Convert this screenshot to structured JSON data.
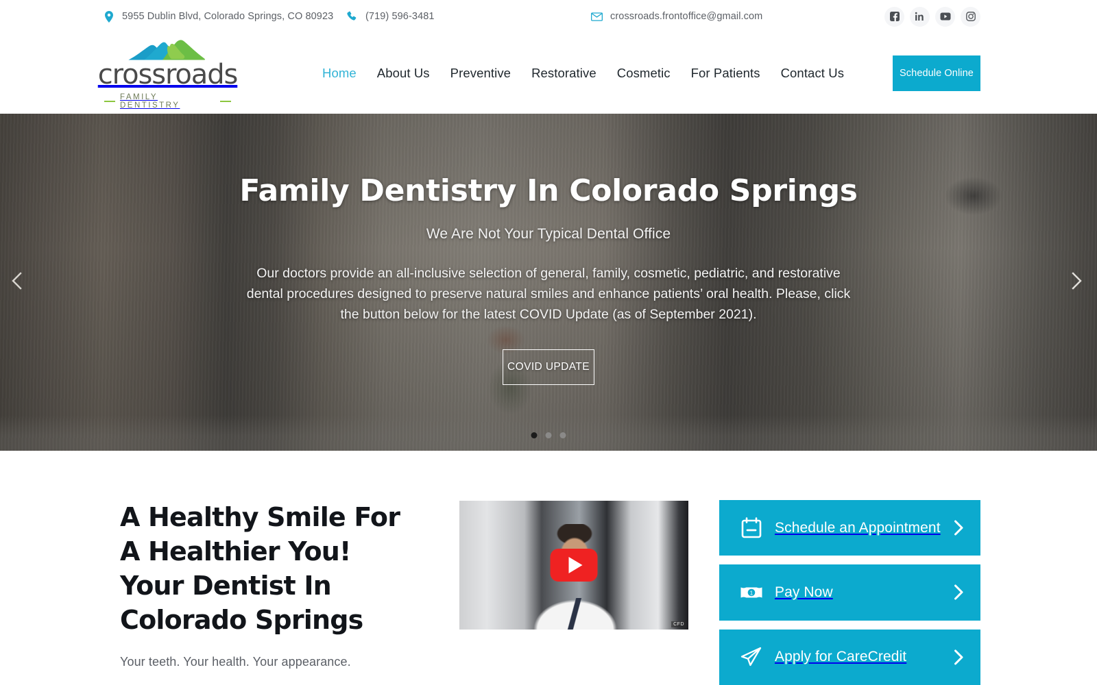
{
  "topbar": {
    "address": "5955 Dublin Blvd, Colorado Springs, CO 80923",
    "phone": "(719) 596-3481",
    "email": "crossroads.frontoffice@gmail.com",
    "socials": [
      {
        "name": "facebook-icon",
        "label": "Facebook"
      },
      {
        "name": "linkedin-icon",
        "label": "LinkedIn"
      },
      {
        "name": "youtube-icon",
        "label": "YouTube"
      },
      {
        "name": "instagram-icon",
        "label": "Instagram"
      }
    ]
  },
  "brand": {
    "name": "crossroads",
    "tagline": "FAMILY DENTISTRY",
    "mark_blue": "#1a9dc8",
    "mark_green": "#6cbe45"
  },
  "nav": {
    "items": [
      {
        "label": "Home",
        "active": true
      },
      {
        "label": "About Us",
        "active": false
      },
      {
        "label": "Preventive",
        "active": false
      },
      {
        "label": "Restorative",
        "active": false
      },
      {
        "label": "Cosmetic",
        "active": false
      },
      {
        "label": "For Patients",
        "active": false
      },
      {
        "label": "Contact Us",
        "active": false
      }
    ],
    "cta_label": "Schedule Online"
  },
  "hero": {
    "title": "Family Dentistry In Colorado Springs",
    "subtitle": "We Are Not Your Typical Dental Office",
    "body": "Our doctors provide an all-inclusive selection of general, family, cosmetic, pediatric, and restorative dental procedures designed to preserve natural smiles and enhance patients’ oral health. Please, click the button below for the latest COVID Update (as of September 2021).",
    "button_label": "COVID UPDATE",
    "slide_count": 3,
    "active_slide": 1,
    "prev_icon": "chevron-left-icon",
    "next_icon": "chevron-right-icon"
  },
  "main": {
    "heading_line1": "A Healthy Smile For",
    "heading_line2": "A Healthier You!",
    "heading_line3": "Your Dentist In",
    "heading_line4": "Colorado Springs",
    "lede": "Your teeth. Your health. Your appearance.",
    "lede2": "",
    "video": {
      "provider": "youtube",
      "play_label": "Play",
      "watermark": "CFD"
    },
    "cta_buttons": [
      {
        "label": "Schedule an Appointment",
        "icon": "calendar-icon",
        "chevron": "chevron-right-icon"
      },
      {
        "label": "Pay Now",
        "icon": "money-bill-icon",
        "chevron": "chevron-right-icon"
      },
      {
        "label": "Apply for CareCredit",
        "icon": "paper-plane-icon",
        "chevron": "chevron-right-icon"
      }
    ]
  },
  "colors": {
    "accent_teal": "#0CAACE",
    "nav_active": "#31b3d6",
    "text_dark": "#12151a",
    "text_muted": "#5b5f66"
  }
}
